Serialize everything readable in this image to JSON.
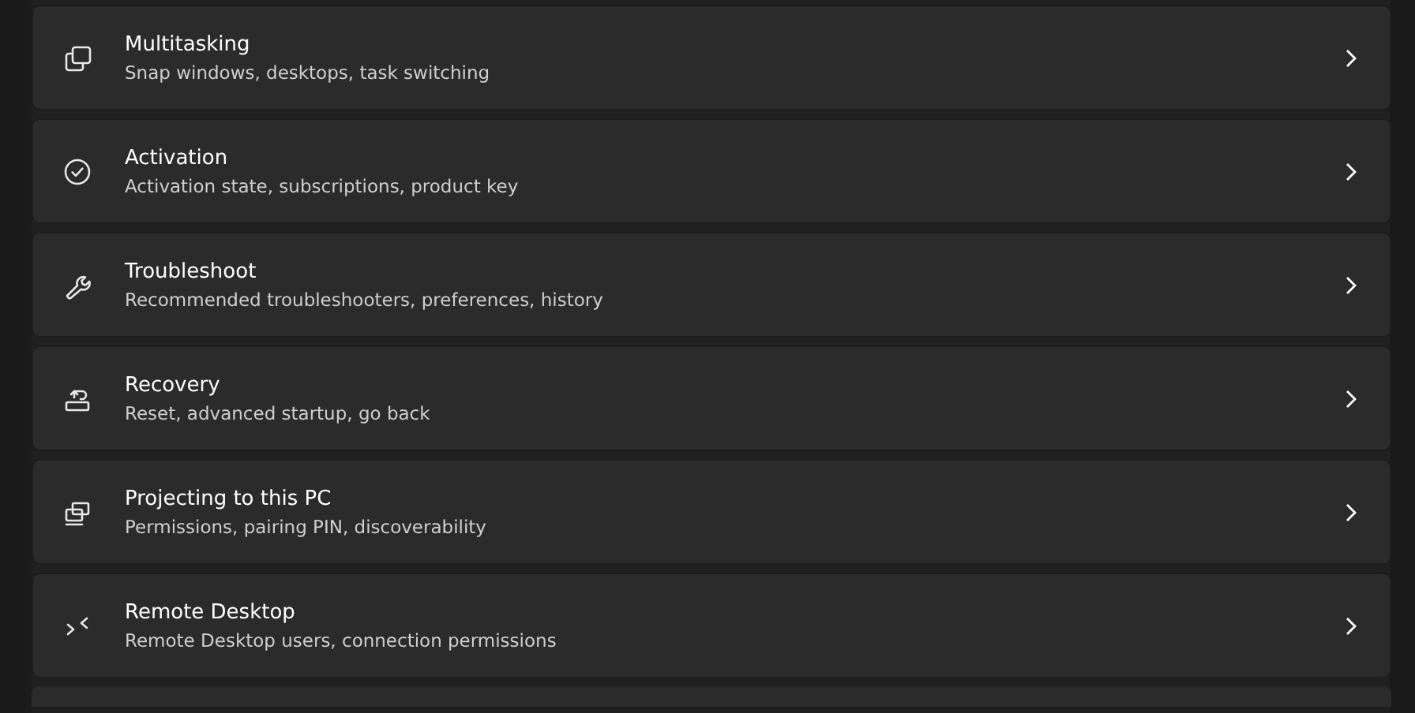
{
  "items": [
    {
      "kind": "multitasking",
      "title": "Multitasking",
      "subtitle": "Snap windows, desktops, task switching"
    },
    {
      "kind": "activation",
      "title": "Activation",
      "subtitle": "Activation state, subscriptions, product key"
    },
    {
      "kind": "troubleshoot",
      "title": "Troubleshoot",
      "subtitle": "Recommended troubleshooters, preferences, history"
    },
    {
      "kind": "recovery",
      "title": "Recovery",
      "subtitle": "Reset, advanced startup, go back"
    },
    {
      "kind": "projecting",
      "title": "Projecting to this PC",
      "subtitle": "Permissions, pairing PIN, discoverability"
    },
    {
      "kind": "remote",
      "title": "Remote Desktop",
      "subtitle": "Remote Desktop users, connection permissions"
    }
  ]
}
